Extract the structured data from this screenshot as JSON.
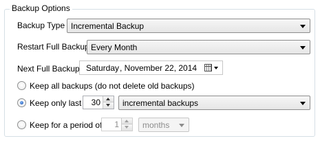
{
  "group": {
    "title": "Backup Options"
  },
  "backup_type": {
    "label": "Backup Type",
    "value": "Incremental Backup"
  },
  "restart_full": {
    "label": "Restart Full Backup",
    "value": "Every Month"
  },
  "next_full": {
    "label": "Next Full Backup",
    "day": "Saturday",
    "date": ", November 22, 2014"
  },
  "options": {
    "keep_all": {
      "label": "Keep all backups (do not delete old backups)",
      "selected": false
    },
    "keep_last": {
      "label": "Keep only last",
      "count": "30",
      "unit": "incremental backups",
      "selected": true
    },
    "keep_period": {
      "label": "Keep for a period of",
      "count": "1",
      "unit": "months",
      "selected": false
    }
  }
}
